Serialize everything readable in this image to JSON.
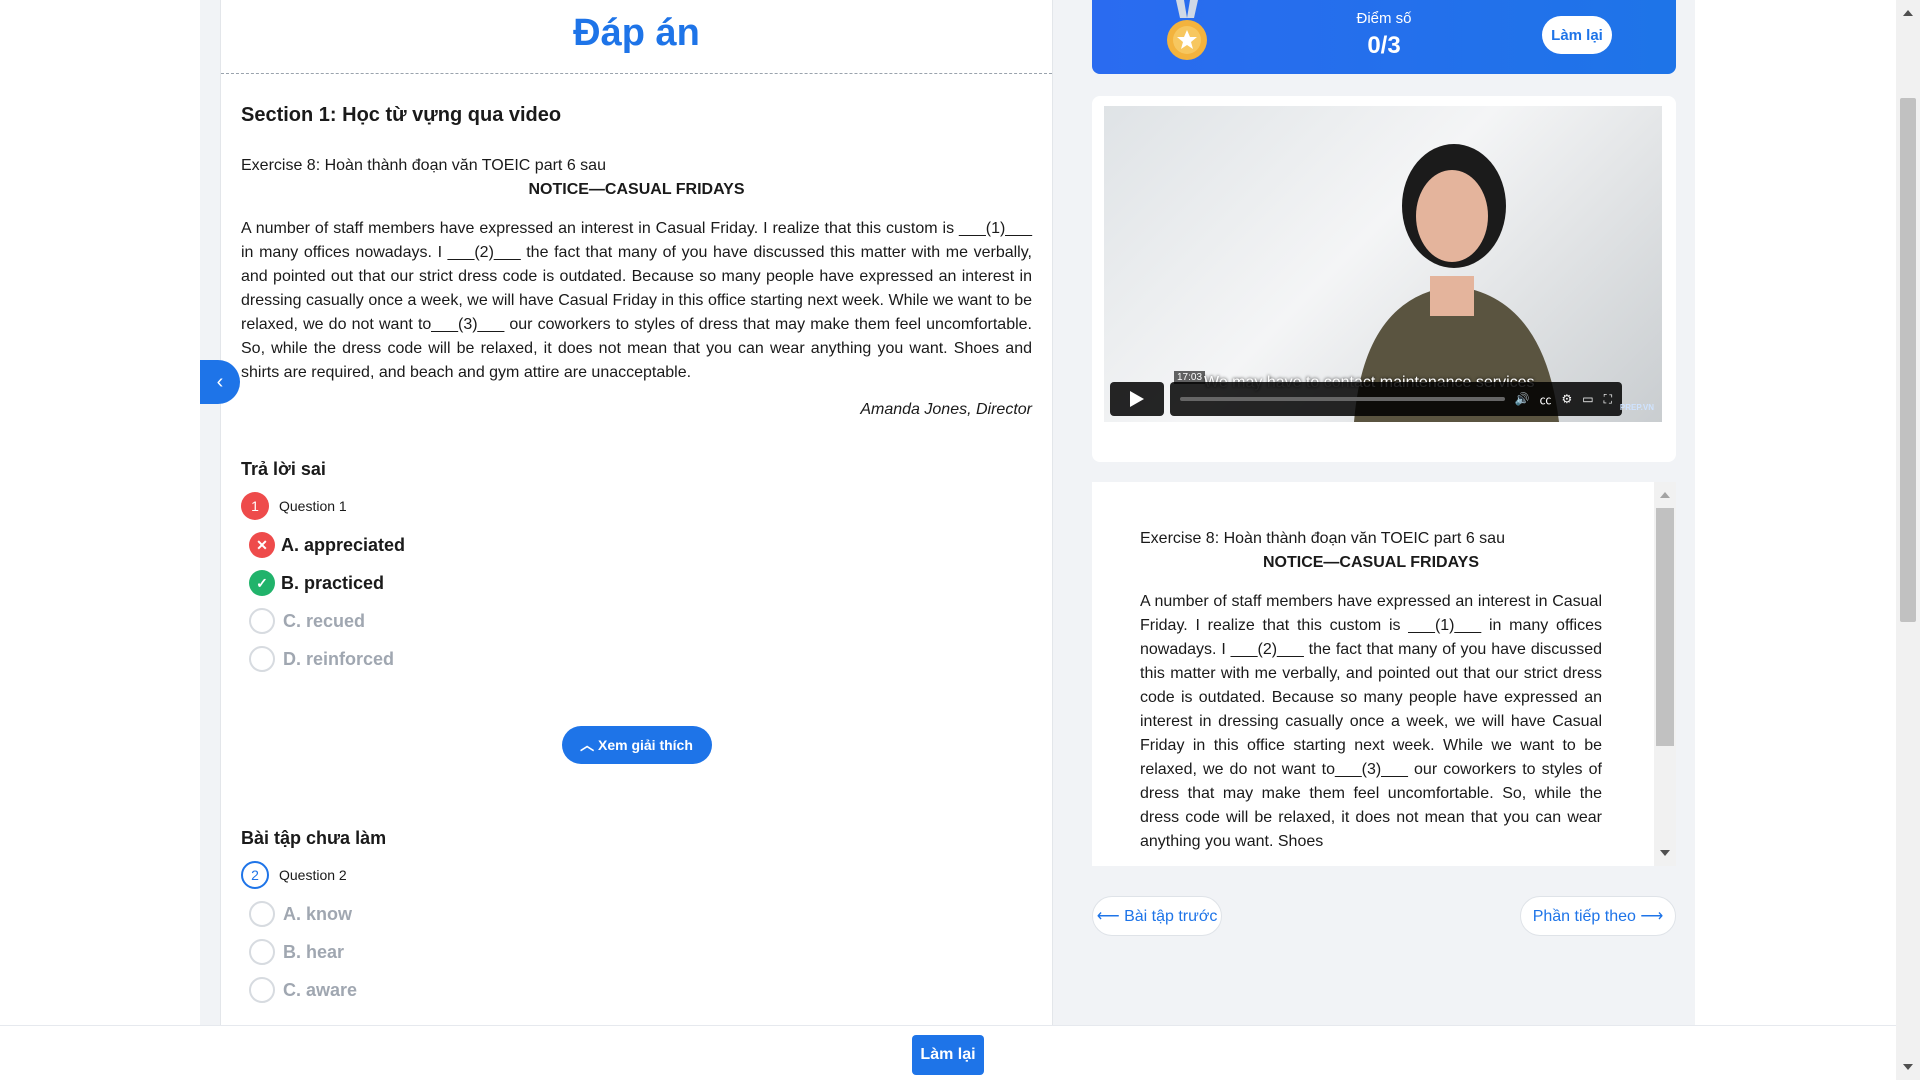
{
  "page": {
    "title": "Đáp án",
    "section_title": "Section 1: Học từ vựng qua video",
    "exercise_title": "Exercise 8: Hoàn thành đoạn văn TOEIC part 6 sau",
    "notice_title": "NOTICE—CASUAL FRIDAYS",
    "passage": "A number of staff members have expressed an interest in Casual Friday. I realize that this custom is ___(1)___ in many offices nowadays. I ___(2)___ the fact that many of you have discussed this matter with me verbally, and pointed out that our strict dress code is outdated. Because so many people have expressed an interest in dressing casually once a week, we will have Casual Friday in this office starting next week. While we want to be relaxed, we do not want  to___(3)___ our coworkers to styles of dress that may make them feel uncomfortable. So, while the dress code will be relaxed, it does not mean that you can wear anything you want. Shoes and shirts are required, and beach and gym attire are unacceptable.",
    "signature": "Amanda Jones, Director"
  },
  "wrong_group": {
    "title": "Trả lời sai",
    "question_number": "1",
    "question_label": "Question 1",
    "options": [
      "A. appreciated",
      "B. practiced",
      "C. recued",
      "D. reinforced"
    ],
    "explain_button": "Xem giải thích"
  },
  "pending_group": {
    "title": "Bài tập chưa làm",
    "question_number": "2",
    "question_label": "Question 2",
    "options": [
      "A. know",
      "B. hear",
      "C. aware"
    ]
  },
  "score": {
    "label": "Điểm số",
    "value": "0/3",
    "retry_label": "Làm lại"
  },
  "video": {
    "time": "17:03",
    "caption": "We may have to contact maintenance services",
    "logo": "PREP.VN"
  },
  "reading_panel": {
    "passage_visible": "A number of staff members have expressed an interest in Casual Friday. I realize that this custom is ___(1)___ in many offices nowadays. I ___(2)___ the fact that many of you have discussed this matter with me verbally, and pointed out that our strict dress code is outdated. Because so many people have expressed an interest in dressing casually once a week, we will have Casual Friday in this office starting next week. While we want to be relaxed, we do not want  to___(3)___ our coworkers to styles of dress that may make them feel uncomfortable. So, while the dress code will be relaxed, it does not mean that you can wear anything you want. Shoes"
  },
  "nav": {
    "prev": "Bài tập trước",
    "next": "Phần tiếp theo"
  },
  "footer": {
    "retry": "Làm lại"
  },
  "colors": {
    "accent": "#1e74e8",
    "wrong": "#ee4b4b",
    "correct": "#21b36b"
  }
}
